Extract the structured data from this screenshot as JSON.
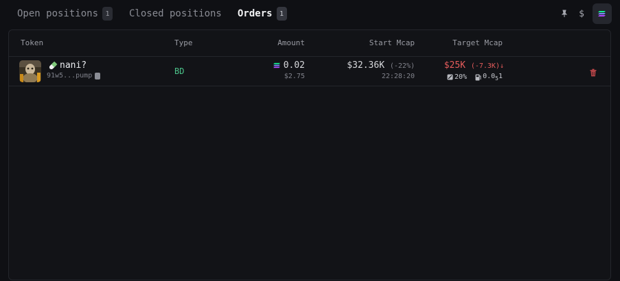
{
  "tabs": [
    {
      "label": "Open positions",
      "count": "1"
    },
    {
      "label": "Closed positions"
    },
    {
      "label": "Orders",
      "count": "1"
    }
  ],
  "toolbar": {
    "dollar_label": "$"
  },
  "table": {
    "headers": [
      "Token",
      "Type",
      "Amount",
      "Start Mcap",
      "Target Mcap"
    ],
    "rows": [
      {
        "token_name": "nani?",
        "token_address": "91w5...pump",
        "type": "BD",
        "amount_sol": "0.02",
        "amount_usd": "$2.75",
        "start_mcap": "$32.36K",
        "start_change": "(-22%)",
        "start_time": "22:28:20",
        "target_mcap": "$25K",
        "target_change": "(-7.3K)↓",
        "slippage": "20%",
        "fee_prefix": "0.0",
        "fee_sub": "5",
        "fee_suffix": "1"
      }
    ]
  },
  "colors": {
    "accent_green": "#4cc38a",
    "accent_red": "#e65c5c",
    "background": "#0f1014"
  }
}
